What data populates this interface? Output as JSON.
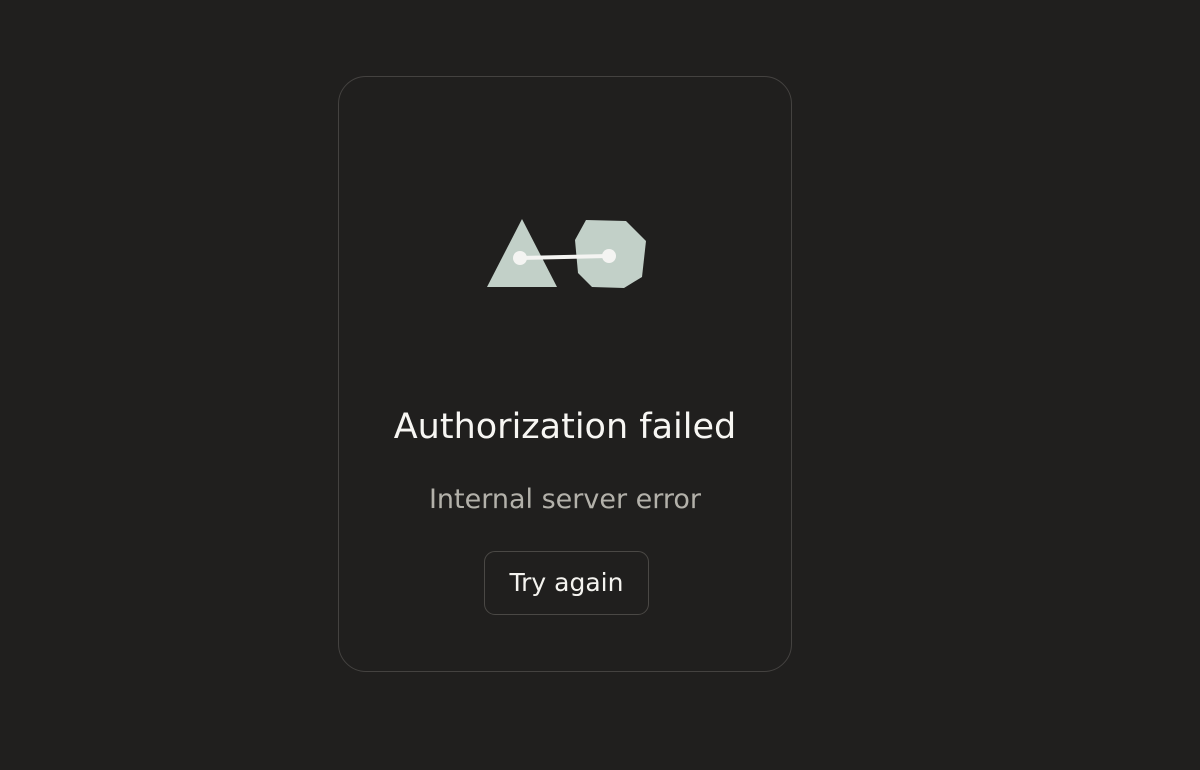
{
  "error_card": {
    "title": "Authorization failed",
    "message": "Internal server error",
    "retry_label": "Try again",
    "illustration": {
      "icon_name": "disconnected-shapes-icon",
      "shape_color": "#c2d0c8",
      "connector_color": "#f4f4f2"
    }
  },
  "colors": {
    "page_background": "#201f1e",
    "card_border": "#444240",
    "title_text": "#f7f6f3",
    "message_text": "#b3b1aa",
    "button_border": "#4a4845"
  }
}
